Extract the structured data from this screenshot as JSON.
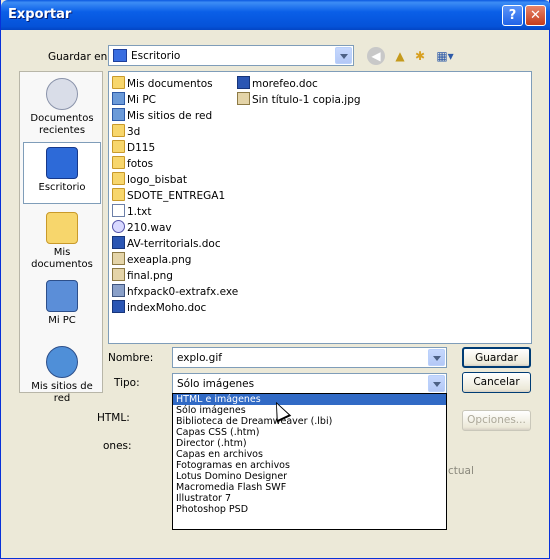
{
  "window": {
    "title": "Exportar"
  },
  "titlebar": {
    "help_label": "?",
    "close_label": "✕"
  },
  "save_in": {
    "label": "Guardar en:",
    "value": "Escritorio"
  },
  "places": [
    {
      "label": "Documentos recientes",
      "icon": "recent-documents-icon"
    },
    {
      "label": "Escritorio",
      "icon": "desktop-icon"
    },
    {
      "label": "Mis documentos",
      "icon": "my-documents-icon"
    },
    {
      "label": "Mi PC",
      "icon": "my-computer-icon"
    },
    {
      "label": "Mis sitios de red",
      "icon": "network-places-icon"
    }
  ],
  "files": [
    {
      "name": "Mis documentos",
      "icon": "folder-icon"
    },
    {
      "name": "Mi PC",
      "icon": "computer-icon"
    },
    {
      "name": "Mis sitios de red",
      "icon": "network-icon"
    },
    {
      "name": "3d",
      "icon": "folder-icon"
    },
    {
      "name": "D115",
      "icon": "folder-icon"
    },
    {
      "name": "fotos",
      "icon": "folder-icon"
    },
    {
      "name": "logo_bisbat",
      "icon": "folder-icon"
    },
    {
      "name": "SDOTE_ENTREGA1",
      "icon": "folder-icon"
    },
    {
      "name": "1.txt",
      "icon": "text-file-icon"
    },
    {
      "name": "210.wav",
      "icon": "audio-file-icon"
    },
    {
      "name": "AV-territorials.doc",
      "icon": "word-doc-icon"
    },
    {
      "name": "exeapla.png",
      "icon": "image-file-icon"
    },
    {
      "name": "final.png",
      "icon": "image-file-icon"
    },
    {
      "name": "hfxpack0-extrafx.exe",
      "icon": "exe-file-icon"
    },
    {
      "name": "indexMoho.doc",
      "icon": "word-doc-icon"
    },
    {
      "name": "morefeo.doc",
      "icon": "word-doc-icon"
    },
    {
      "name": "Sin título-1 copia.jpg",
      "icon": "image-file-icon"
    }
  ],
  "filename": {
    "label": "Nombre:",
    "value": "explo.gif"
  },
  "filetype": {
    "label": "Tipo:",
    "value": "Sólo imágenes"
  },
  "buttons": {
    "save": "Guardar",
    "cancel": "Cancelar",
    "options": "Opciones..."
  },
  "partial_labels": {
    "html": "HTML:",
    "options": "ones:",
    "current": "ctual"
  },
  "dropdown_options": [
    "HTML e imágenes",
    "Sólo imágenes",
    "Biblioteca de Dreamweaver (.lbi)",
    "Capas CSS (.htm)",
    "Director (.htm)",
    "Capas en archivos",
    "Fotogramas en archivos",
    "Lotus Domino Designer",
    "Macromedia Flash SWF",
    "Illustrator 7",
    "Photoshop PSD"
  ],
  "dropdown_selected_index": 0
}
